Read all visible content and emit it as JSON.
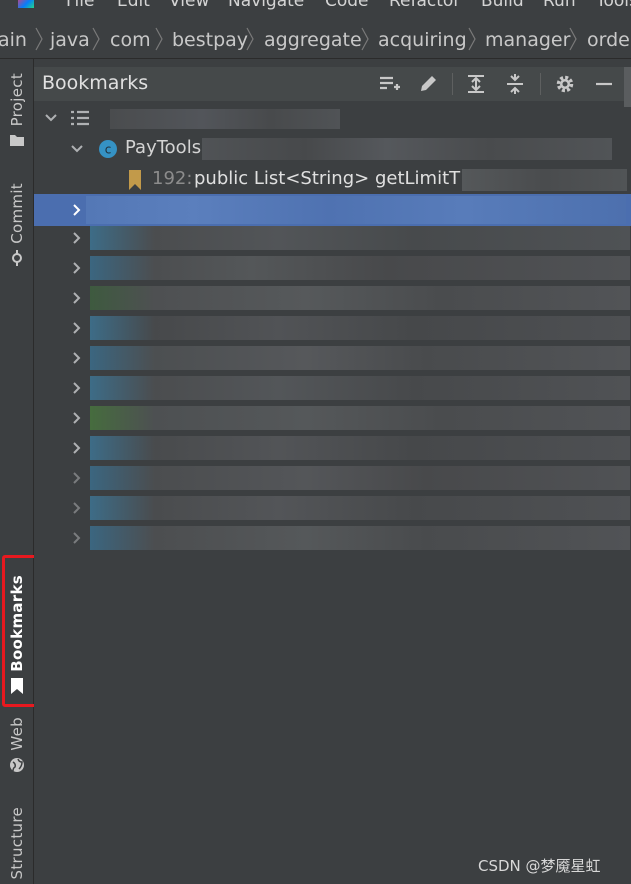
{
  "menu": [
    "File",
    "Edit",
    "View",
    "Navigate",
    "Code",
    "Refactor",
    "Build",
    "Run",
    "Tools"
  ],
  "breadcrumb": [
    "ain",
    "java",
    "com",
    "bestpay",
    "aggregate",
    "acquiring",
    "manager",
    "orde"
  ],
  "sidebar": {
    "project": "Project",
    "commit": "Commit",
    "bookmarks": "Bookmarks",
    "web": "Web",
    "structure": "Structure"
  },
  "panel": {
    "title": "Bookmarks",
    "class_node": "PayToolsC",
    "class_icon_letter": "c",
    "bookmark_line": "192:",
    "bookmark_text": "public List<String> getLimitT"
  },
  "colors": {
    "selection": "#4b6eaf",
    "class_icon": "#3592c4",
    "bookmark": "#c29a4a",
    "highlight_box": "#e8191f"
  },
  "watermark": "CSDN @梦魇星虹"
}
